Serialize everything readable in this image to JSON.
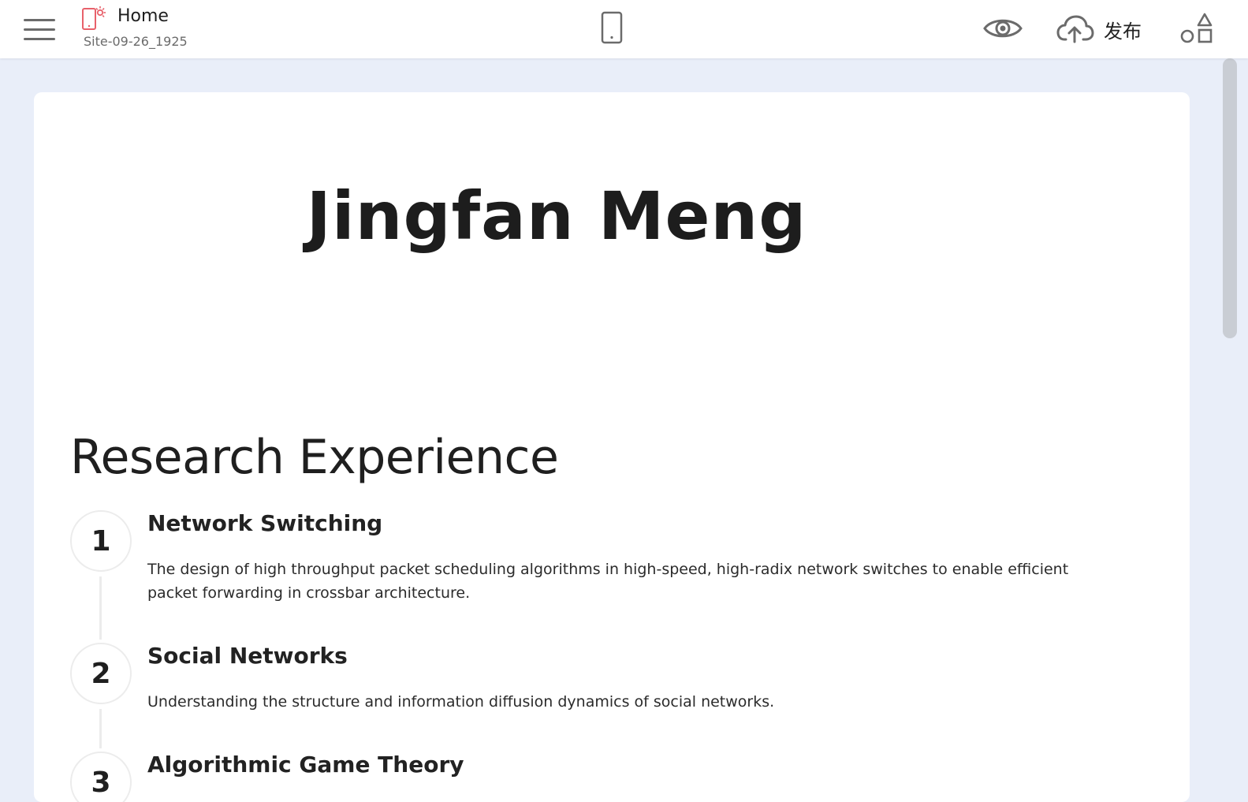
{
  "header": {
    "page_name": "Home",
    "site_name": "Site-09-26_1925",
    "publish_label": "发布"
  },
  "icons": {
    "menu": "hamburger-icon",
    "logo": "site-builder-logo-icon",
    "device": "mobile-phone-icon",
    "preview": "eye-icon",
    "publish": "cloud-upload-icon",
    "elements": "shapes-icon"
  },
  "colors": {
    "logo_accent": "#e8616b",
    "page_background": "#e9eef9",
    "icon_gray": "#6b6b6b"
  },
  "canvas": {
    "hero_title": "Jingfan Meng",
    "section_heading": "Research Experience",
    "timeline": [
      {
        "number": "1",
        "title": "Network Switching",
        "description": "The design of high throughput packet scheduling algorithms in high-speed, high-radix network switches to enable efficient packet forwarding in crossbar architecture."
      },
      {
        "number": "2",
        "title": "Social Networks",
        "description": "Understanding the structure and information diffusion dynamics of social networks."
      },
      {
        "number": "3",
        "title": "Algorithmic Game Theory",
        "description": ""
      }
    ]
  }
}
